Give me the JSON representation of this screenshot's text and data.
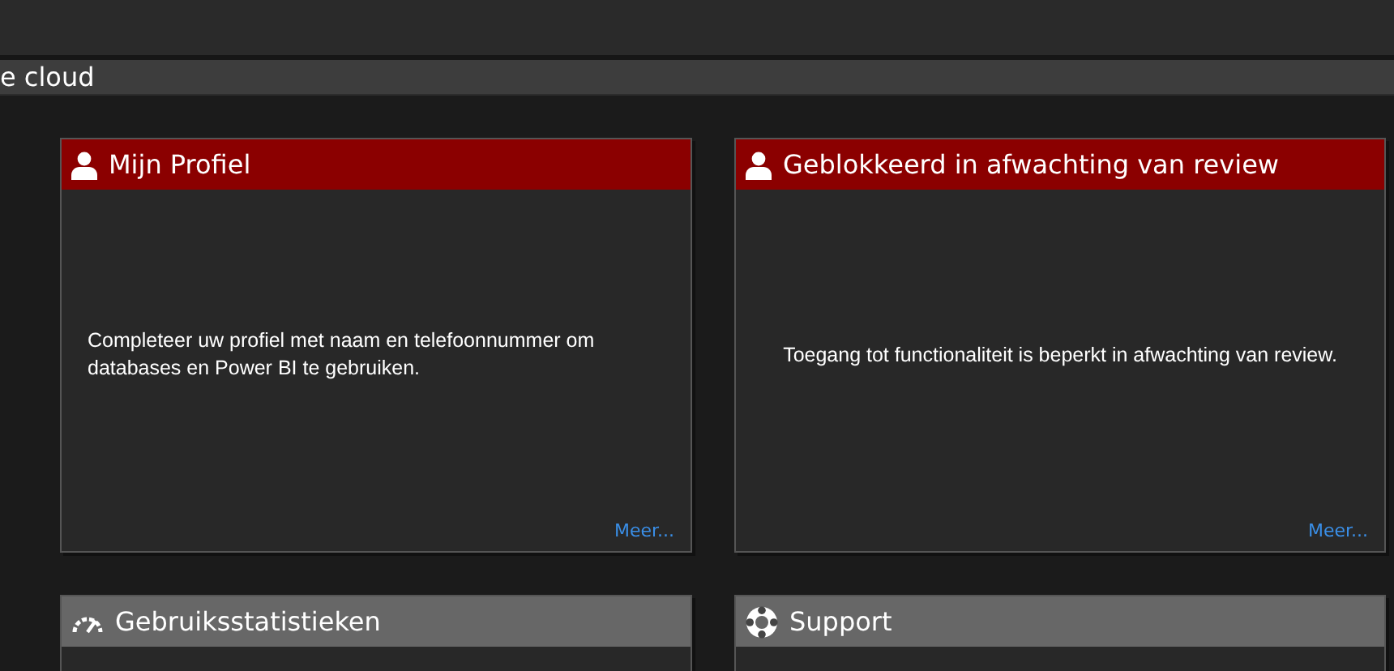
{
  "page_title": "e cloud",
  "cards": [
    {
      "title": "Mijn Profiel",
      "kind": "alert",
      "body": "Completeer uw profiel met naam en telefoonnummer om databases en Power BI te gebruiken.",
      "link": "Meer..."
    },
    {
      "title": "Geblokkeerd in afwachting van review",
      "kind": "alert",
      "body": "Toegang tot functionaliteit is beperkt in afwachting van review.",
      "link": "Meer..."
    },
    {
      "title": "Gebruiksstatistieken",
      "kind": "normal"
    },
    {
      "title": "Support",
      "kind": "normal"
    }
  ]
}
